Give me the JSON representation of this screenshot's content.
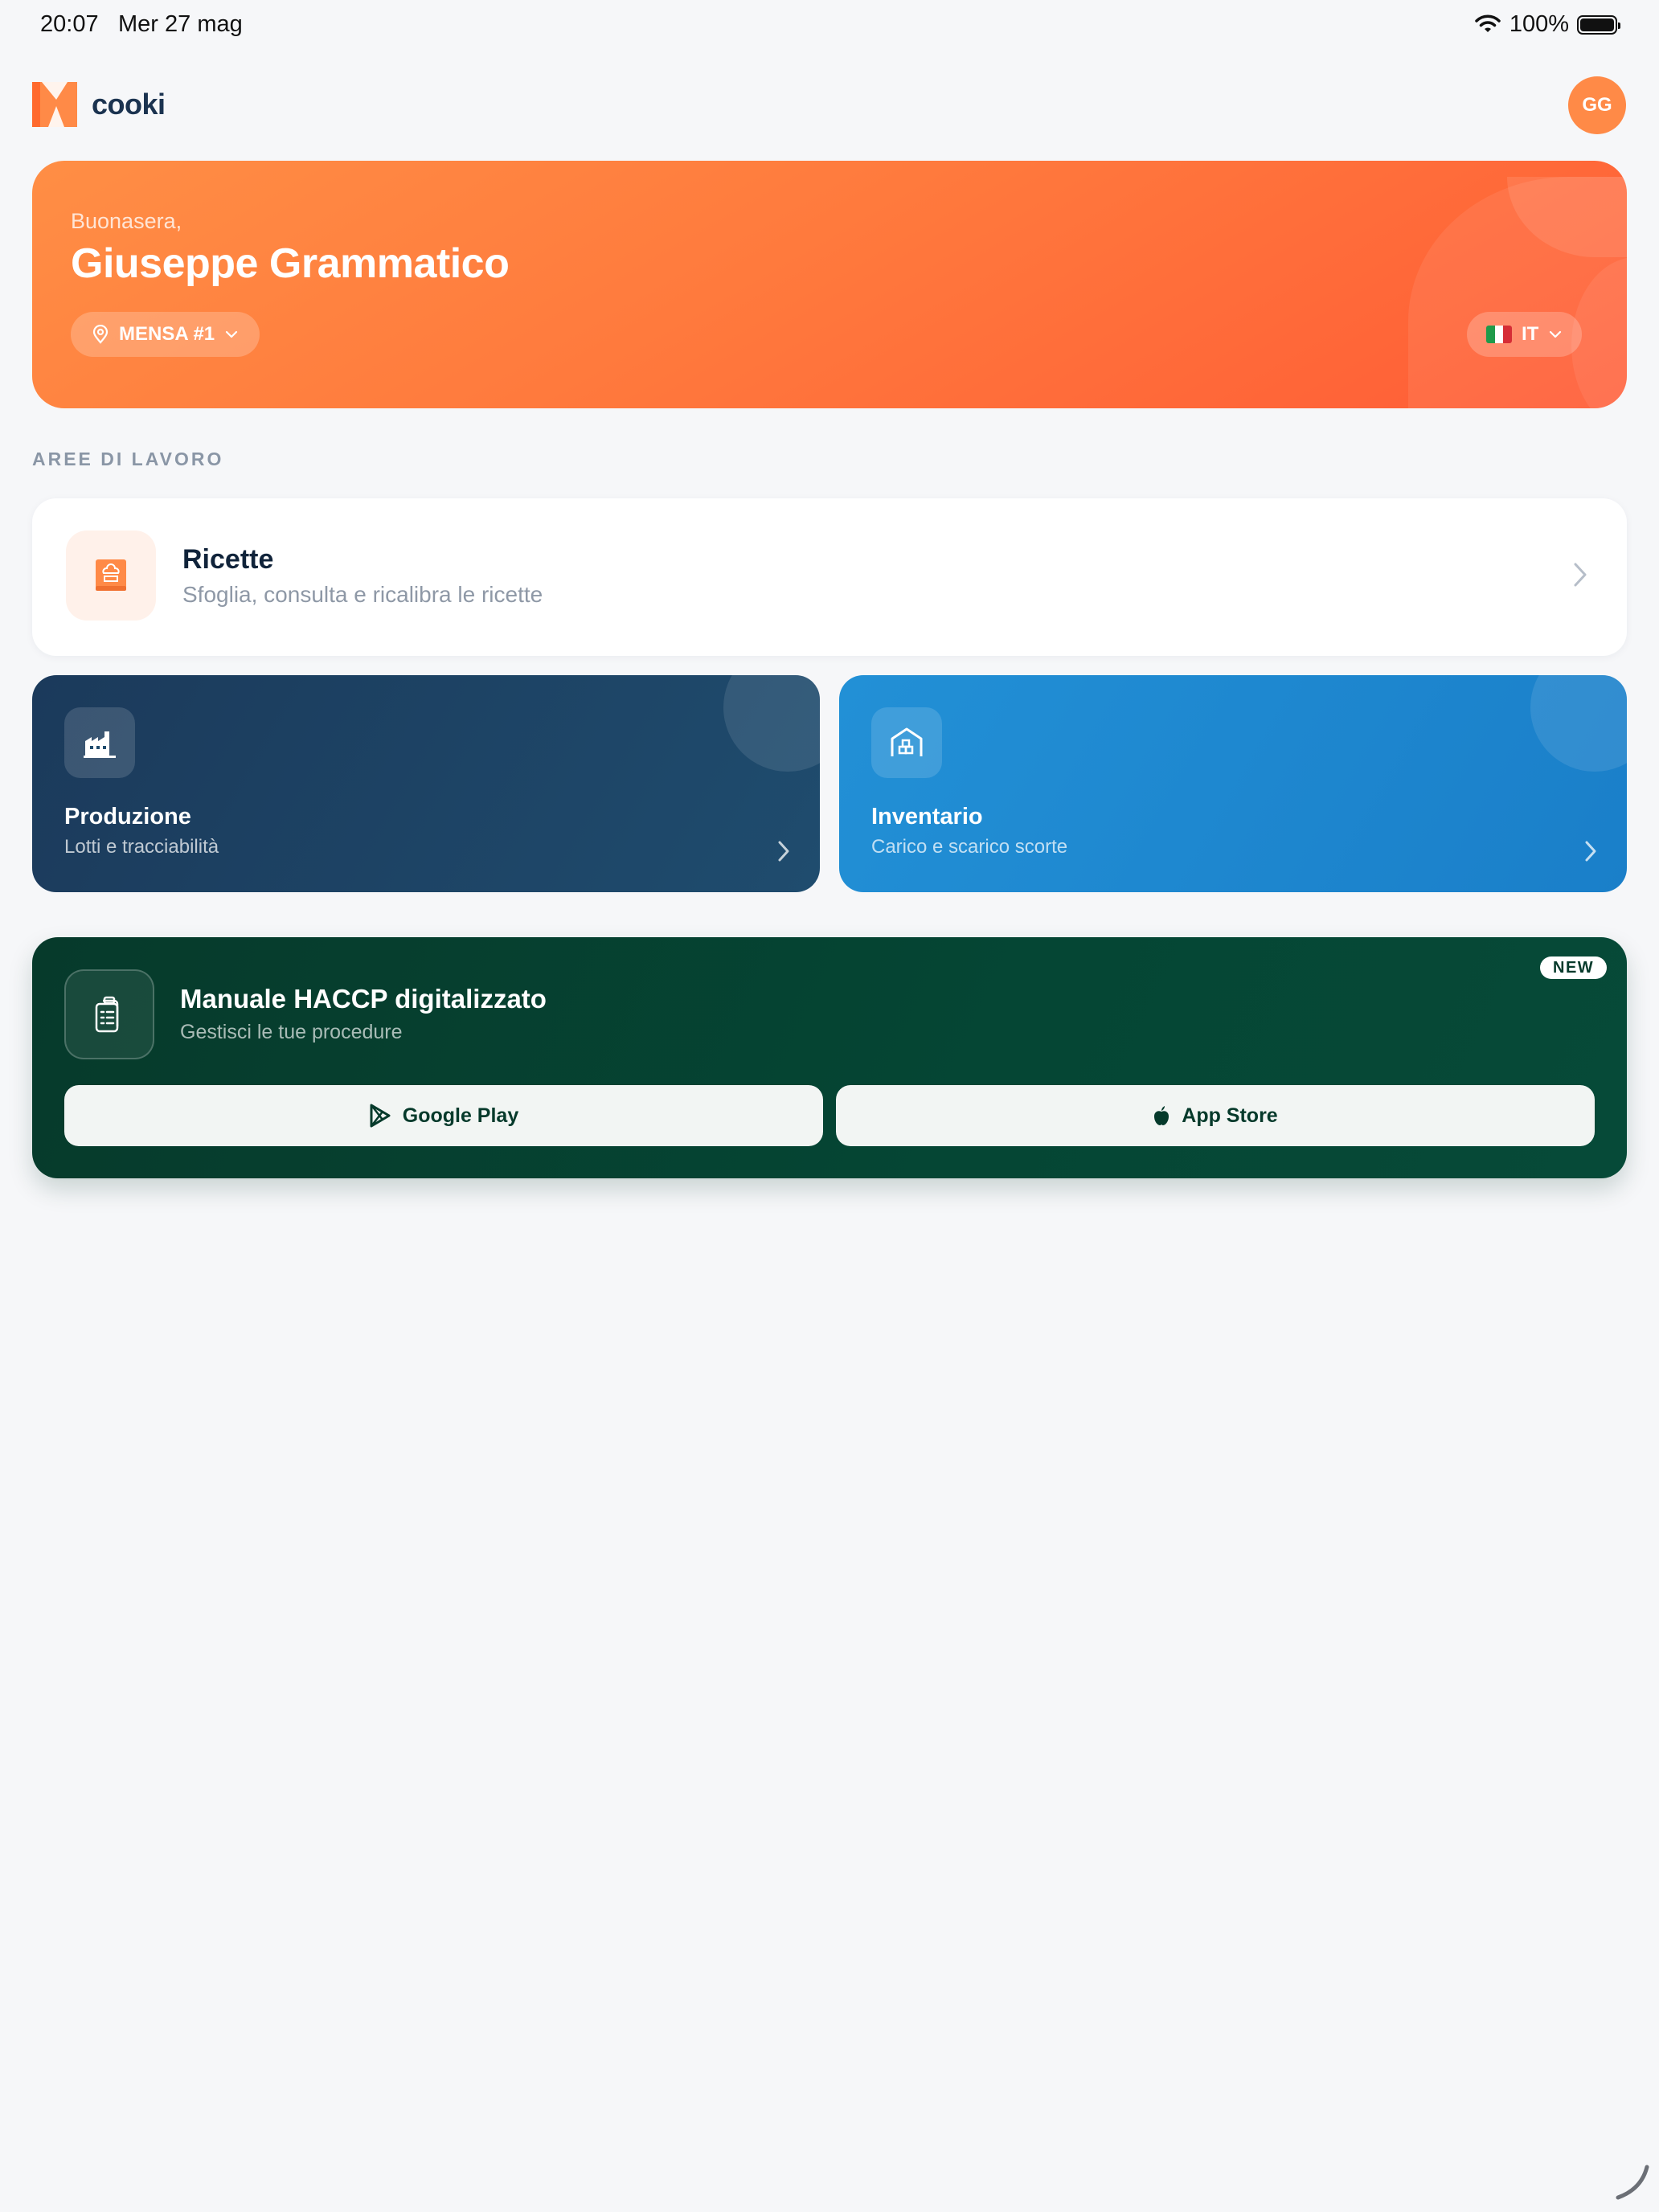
{
  "status_bar": {
    "time": "20:07",
    "date": "Mer 27 mag",
    "battery": "100%"
  },
  "header": {
    "app_name": "cooki",
    "avatar_initials": "GG"
  },
  "hero": {
    "greeting": "Buonasera,",
    "user_name": "Giuseppe Grammatico",
    "location_label": "MENSA #1",
    "language_label": "IT"
  },
  "sections": {
    "work_areas_title": "AREE DI LAVORO"
  },
  "ricette": {
    "title": "Ricette",
    "subtitle": "Sfoglia, consulta e ricalibra le ricette"
  },
  "produzione": {
    "title": "Produzione",
    "subtitle": "Lotti e tracciabilità"
  },
  "inventario": {
    "title": "Inventario",
    "subtitle": "Carico e scarico scorte"
  },
  "haccp": {
    "title": "Manuale HACCP digitalizzato",
    "subtitle": "Gestisci le tue procedure",
    "badge": "NEW",
    "google_play_label": "Google Play",
    "app_store_label": "App Store"
  },
  "colors": {
    "brand_orange": "#ff7a3d",
    "produzione_bg": "#1b3a5b",
    "inventario_bg": "#2290d6",
    "haccp_bg": "#054634",
    "page_bg": "#f6f7f9"
  },
  "icons": {
    "logo": "cooki-logo",
    "location": "location-pin-icon",
    "chevron": "chevron-down-icon",
    "ricette": "cookbook-icon",
    "produzione": "factory-icon",
    "inventario": "warehouse-icon",
    "haccp": "clipboard-icon",
    "google": "google-play-icon",
    "apple": "apple-icon"
  }
}
